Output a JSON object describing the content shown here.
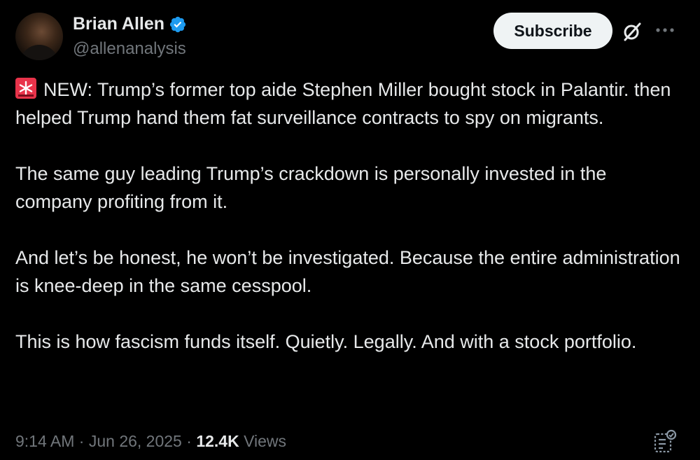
{
  "author": {
    "name": "Brian Allen",
    "handle": "@allenanalysis",
    "verified": true
  },
  "actions": {
    "subscribe_label": "Subscribe",
    "grok_icon": "grok-icon",
    "more_icon": "more-icon"
  },
  "tweet": {
    "lead_icon": "siren-emoji",
    "paragraphs": [
      "NEW: Trump’s former top aide Stephen Miller bought stock in Palantir. then helped Trump hand them fat surveillance contracts to spy on migrants.",
      "The same guy leading Trump’s crackdown is personally invested in the company profiting from it.",
      "And let’s be honest, he won’t be investigated. Because the entire administration is knee-deep in the same cesspool.",
      "This is how fascism funds itself. Quietly. Legally. And with a stock portfolio."
    ]
  },
  "meta": {
    "time": "9:14 AM",
    "separator": "·",
    "date": "Jun 26, 2025",
    "views_count": "12.4K",
    "views_label": "Views"
  },
  "colors": {
    "background": "#000000",
    "text": "#e7e9ea",
    "muted": "#71767b",
    "verified": "#1d9bf0",
    "button_bg": "#eff3f4",
    "siren": "#e8334a"
  }
}
